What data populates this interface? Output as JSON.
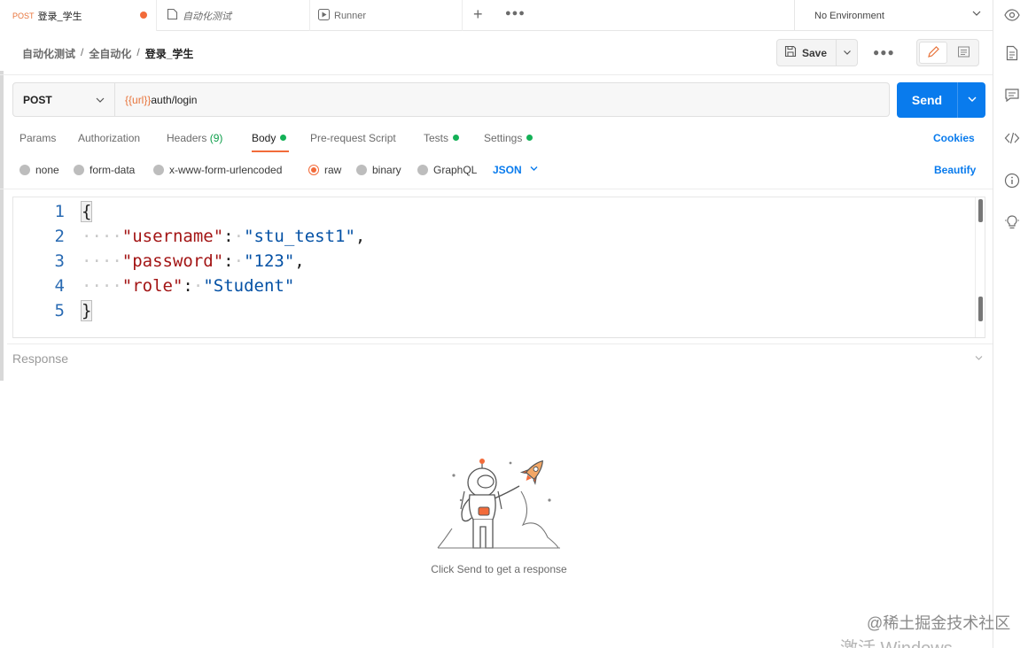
{
  "tabs": [
    {
      "method": "POST",
      "title": "登录_学生",
      "unsaved": true
    },
    {
      "title": "自动化测试"
    },
    {
      "title": "Runner"
    }
  ],
  "environment": "No Environment",
  "breadcrumb": [
    "自动化测试",
    "全自动化",
    "登录_学生"
  ],
  "save_label": "Save",
  "request": {
    "method": "POST",
    "url_variable": "{{url}}",
    "url_path": "auth/login",
    "send_label": "Send"
  },
  "request_tabs": [
    {
      "label": "Params"
    },
    {
      "label": "Authorization"
    },
    {
      "label": "Headers",
      "count": "(9)"
    },
    {
      "label": "Body",
      "active": true
    },
    {
      "label": "Pre-request Script"
    },
    {
      "label": "Tests"
    },
    {
      "label": "Settings"
    }
  ],
  "cookies_label": "Cookies",
  "body_types": [
    "none",
    "form-data",
    "x-www-form-urlencoded",
    "raw",
    "binary",
    "GraphQL"
  ],
  "body_format": "JSON",
  "beautify_label": "Beautify",
  "code": {
    "line_numbers": [
      "1",
      "2",
      "3",
      "4",
      "5"
    ],
    "open_brace": "{",
    "close_brace": "}",
    "indent": "····",
    "fields": [
      {
        "key": "\"username\"",
        "value": "\"stu_test1\"",
        "trail": ","
      },
      {
        "key": "\"password\"",
        "value": "\"123\"",
        "trail": ","
      },
      {
        "key": "\"role\"",
        "value": "\"Student\"",
        "trail": ""
      }
    ]
  },
  "response": {
    "title": "Response",
    "hint": "Click Send to get a response"
  },
  "watermark": "@稀土掘金技术社区",
  "os_watermark": "激活 Windows",
  "colors": {
    "accent_orange": "#f26b3a",
    "send_blue": "#097bed",
    "status_green": "#14b157"
  }
}
